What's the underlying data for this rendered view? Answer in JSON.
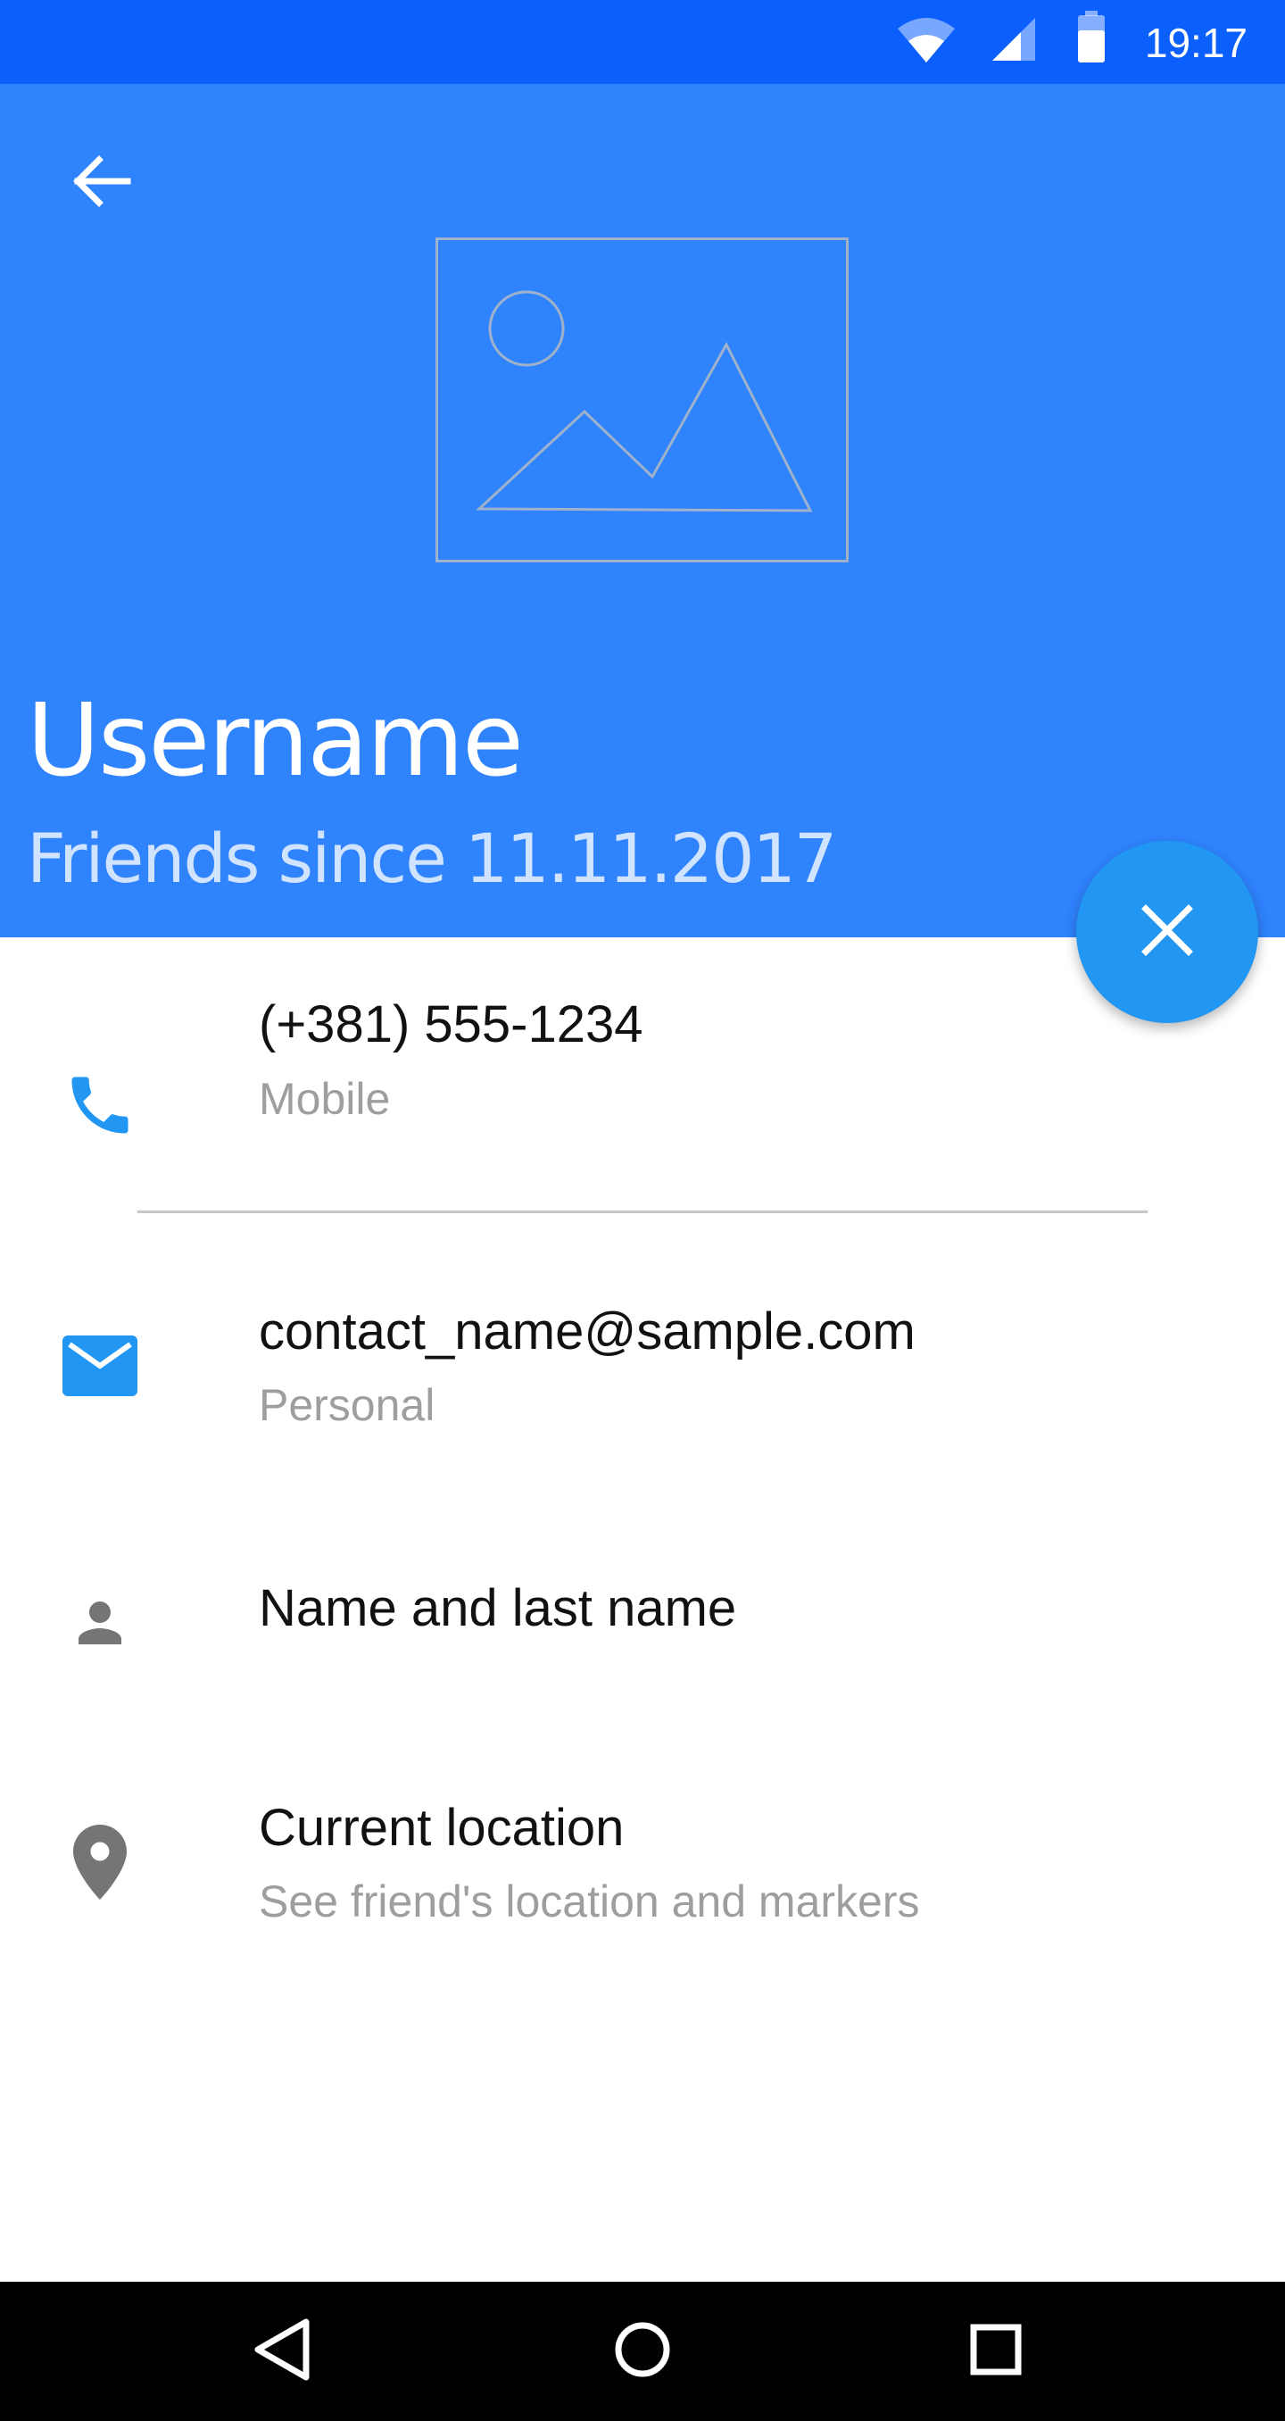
{
  "status_bar": {
    "time": "19:17",
    "icons": [
      "wifi-icon",
      "signal-icon",
      "battery-icon"
    ]
  },
  "header": {
    "back_icon": "arrow-back-icon",
    "image_placeholder_icon": "image-placeholder-icon",
    "username": "Username",
    "friends_since": "Friends since 11.11.2017",
    "fab_icon": "close-icon"
  },
  "contact": {
    "phone": {
      "icon": "phone-icon",
      "value": "(+381) 555-1234",
      "label": "Mobile"
    },
    "email": {
      "icon": "email-icon",
      "value": "contact_name@sample.com",
      "label": "Personal"
    },
    "name": {
      "icon": "person-icon",
      "value": "Name and last name"
    },
    "location": {
      "icon": "location-pin-icon",
      "value": "Current location",
      "label": "See friend's location and markers"
    }
  },
  "nav_bar": {
    "icons": [
      "back-nav-icon",
      "home-nav-icon",
      "recents-nav-icon"
    ]
  },
  "colors": {
    "status_bar": "#0a5ffd",
    "header": "#2f83fd",
    "fab": "#2196f3",
    "accent_icon": "#2196f3",
    "grey_icon": "#757575",
    "secondary_text": "#9e9e9e"
  }
}
